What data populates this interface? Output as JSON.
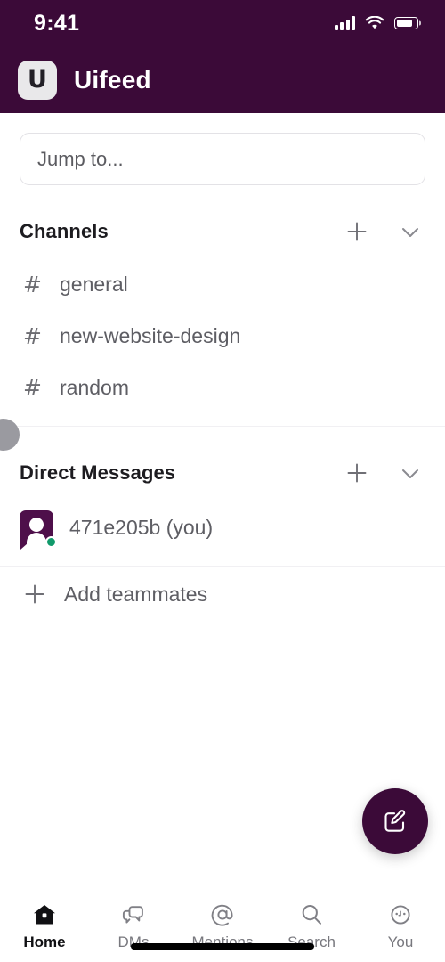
{
  "status_bar": {
    "time": "9:41",
    "signal_icon": "cellular-signal-icon",
    "wifi_icon": "wifi-icon",
    "battery_icon": "battery-icon"
  },
  "header": {
    "logo_letter": "U",
    "workspace_name": "Uifeed",
    "background_color": "#3b0a38"
  },
  "search": {
    "placeholder": "Jump to...",
    "value": ""
  },
  "channels_section": {
    "title": "Channels",
    "add_icon": "plus-icon",
    "collapse_icon": "chevron-down-icon",
    "items": [
      {
        "prefix": "#",
        "label": "general"
      },
      {
        "prefix": "#",
        "label": "new-website-design"
      },
      {
        "prefix": "#",
        "label": "random"
      }
    ]
  },
  "dm_section": {
    "title": "Direct Messages",
    "add_icon": "plus-icon",
    "collapse_icon": "chevron-down-icon",
    "items": [
      {
        "label": "471e205b (you)",
        "avatar_icon": "user-avatar-icon",
        "presence": "online",
        "presence_color": "#119a6b",
        "avatar_color": "#4e0f4a"
      }
    ],
    "add_teammates": {
      "icon": "plus-icon",
      "label": "Add teammates"
    }
  },
  "compose_button": {
    "icon": "compose-pencil-icon",
    "color": "#3b0a38"
  },
  "tab_bar": {
    "active": "Home",
    "tabs": [
      {
        "label": "Home",
        "icon": "home-icon",
        "active": true
      },
      {
        "label": "DMs",
        "icon": "chat-bubbles-icon",
        "active": false
      },
      {
        "label": "Mentions",
        "icon": "at-sign-icon",
        "active": false
      },
      {
        "label": "Search",
        "icon": "magnifier-icon",
        "active": false
      },
      {
        "label": "You",
        "icon": "profile-circle-icon",
        "active": false
      }
    ]
  }
}
